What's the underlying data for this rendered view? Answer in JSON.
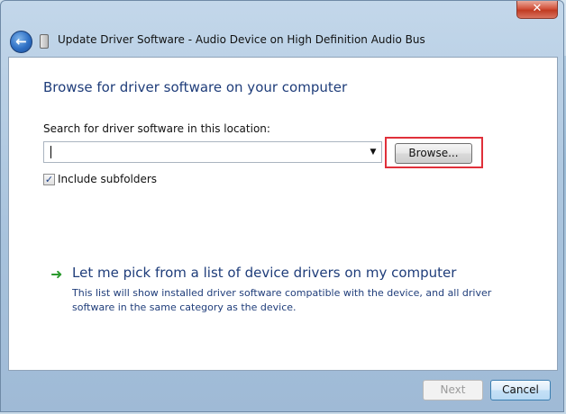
{
  "window": {
    "title": "Update Driver Software - Audio Device on High Definition Audio Bus",
    "close_glyph": "✕",
    "back_glyph": "←"
  },
  "browse_page": {
    "heading": "Browse for driver software on your computer",
    "search_label": "Search for driver software in this location:",
    "path_value": "",
    "dropdown_glyph": "▼",
    "browse_label": "Browse...",
    "include_subfolders_checked": true,
    "include_subfolders_glyph": "✓",
    "include_subfolders_label": "Include subfolders"
  },
  "pick_option": {
    "arrow_glyph": "➜",
    "title": "Let me pick from a list of device drivers on my computer",
    "description": "This list will show installed driver software compatible with the device, and all driver software in the same category as the device."
  },
  "footer": {
    "next_label": "Next",
    "next_enabled": false,
    "cancel_label": "Cancel"
  },
  "icons": {
    "back": "back-arrow-icon",
    "device": "device-icon",
    "close": "close-icon",
    "pick": "green-arrow-icon"
  },
  "colors": {
    "heading": "#1f3d7a",
    "highlight_border": "#e0303a",
    "pick_arrow": "#2b9a2e"
  }
}
